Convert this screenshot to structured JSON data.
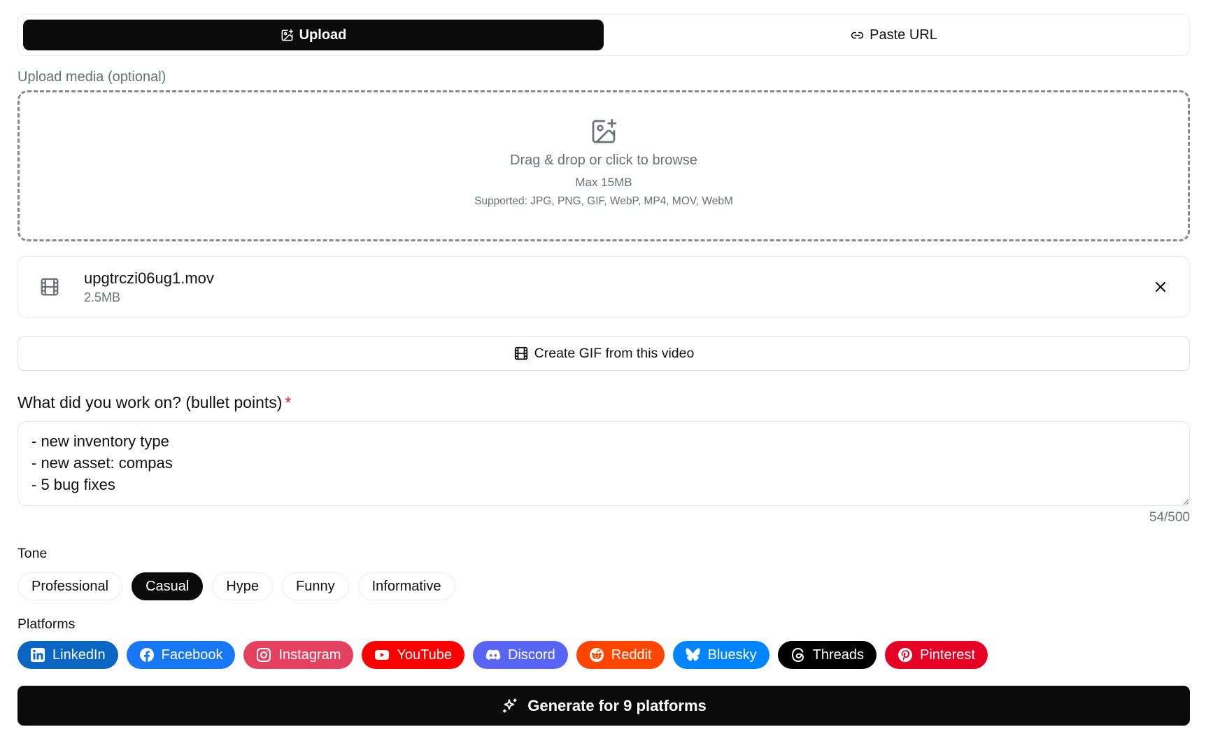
{
  "tabs": [
    {
      "label": "Upload",
      "icon": "image-plus-icon",
      "active": true
    },
    {
      "label": "Paste URL",
      "icon": "link-icon",
      "active": false
    }
  ],
  "upload": {
    "label": "Upload media (optional)",
    "drop_text": "Drag & drop or click to browse",
    "max_text": "Max 15MB",
    "supported_text": "Supported: JPG, PNG, GIF, WebP, MP4, MOV, WebM"
  },
  "file": {
    "name": "upgtrczi06ug1.mov",
    "size": "2.5MB"
  },
  "gif_button": "Create GIF from this video",
  "work": {
    "label": "What did you work on? (bullet points)",
    "required_mark": "*",
    "value": "- new inventory type\n- new asset: compas\n- 5 bug fixes",
    "counter": "54/500"
  },
  "tone": {
    "label": "Tone",
    "options": [
      "Professional",
      "Casual",
      "Hype",
      "Funny",
      "Informative"
    ],
    "selected": "Casual"
  },
  "platforms": {
    "label": "Platforms",
    "items": [
      {
        "label": "LinkedIn",
        "icon": "linkedin-icon",
        "color": "#0a66c2"
      },
      {
        "label": "Facebook",
        "icon": "facebook-icon",
        "color": "#1877f2"
      },
      {
        "label": "Instagram",
        "icon": "instagram-icon",
        "color": "#e4405f"
      },
      {
        "label": "YouTube",
        "icon": "youtube-icon",
        "color": "#ff0000"
      },
      {
        "label": "Discord",
        "icon": "discord-icon",
        "color": "#5865f2"
      },
      {
        "label": "Reddit",
        "icon": "reddit-icon",
        "color": "#ff4500"
      },
      {
        "label": "Bluesky",
        "icon": "bluesky-icon",
        "color": "#0085ff"
      },
      {
        "label": "Threads",
        "icon": "threads-icon",
        "color": "#000000"
      },
      {
        "label": "Pinterest",
        "icon": "pinterest-icon",
        "color": "#e60023"
      }
    ]
  },
  "generate_button": "Generate for 9 platforms"
}
